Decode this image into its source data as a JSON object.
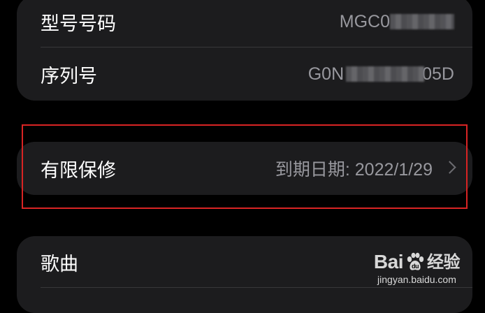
{
  "sections": {
    "device_info": {
      "rows": [
        {
          "label": "型号号码",
          "value": "MGC0"
        },
        {
          "label": "序列号",
          "value_prefix": "G0N",
          "value_suffix": "05D"
        }
      ]
    },
    "warranty": {
      "label": "有限保修",
      "value": "到期日期: 2022/1/29"
    },
    "media": {
      "rows": [
        {
          "label": "歌曲"
        }
      ]
    }
  },
  "watermark": {
    "brand_left": "Bai",
    "brand_right": "经验",
    "url": "jingyan.baidu.com"
  },
  "colors": {
    "background": "#000000",
    "group_background": "#1c1c1e",
    "label": "#ffffff",
    "value": "#98989e",
    "highlight_border": "#d92424"
  }
}
